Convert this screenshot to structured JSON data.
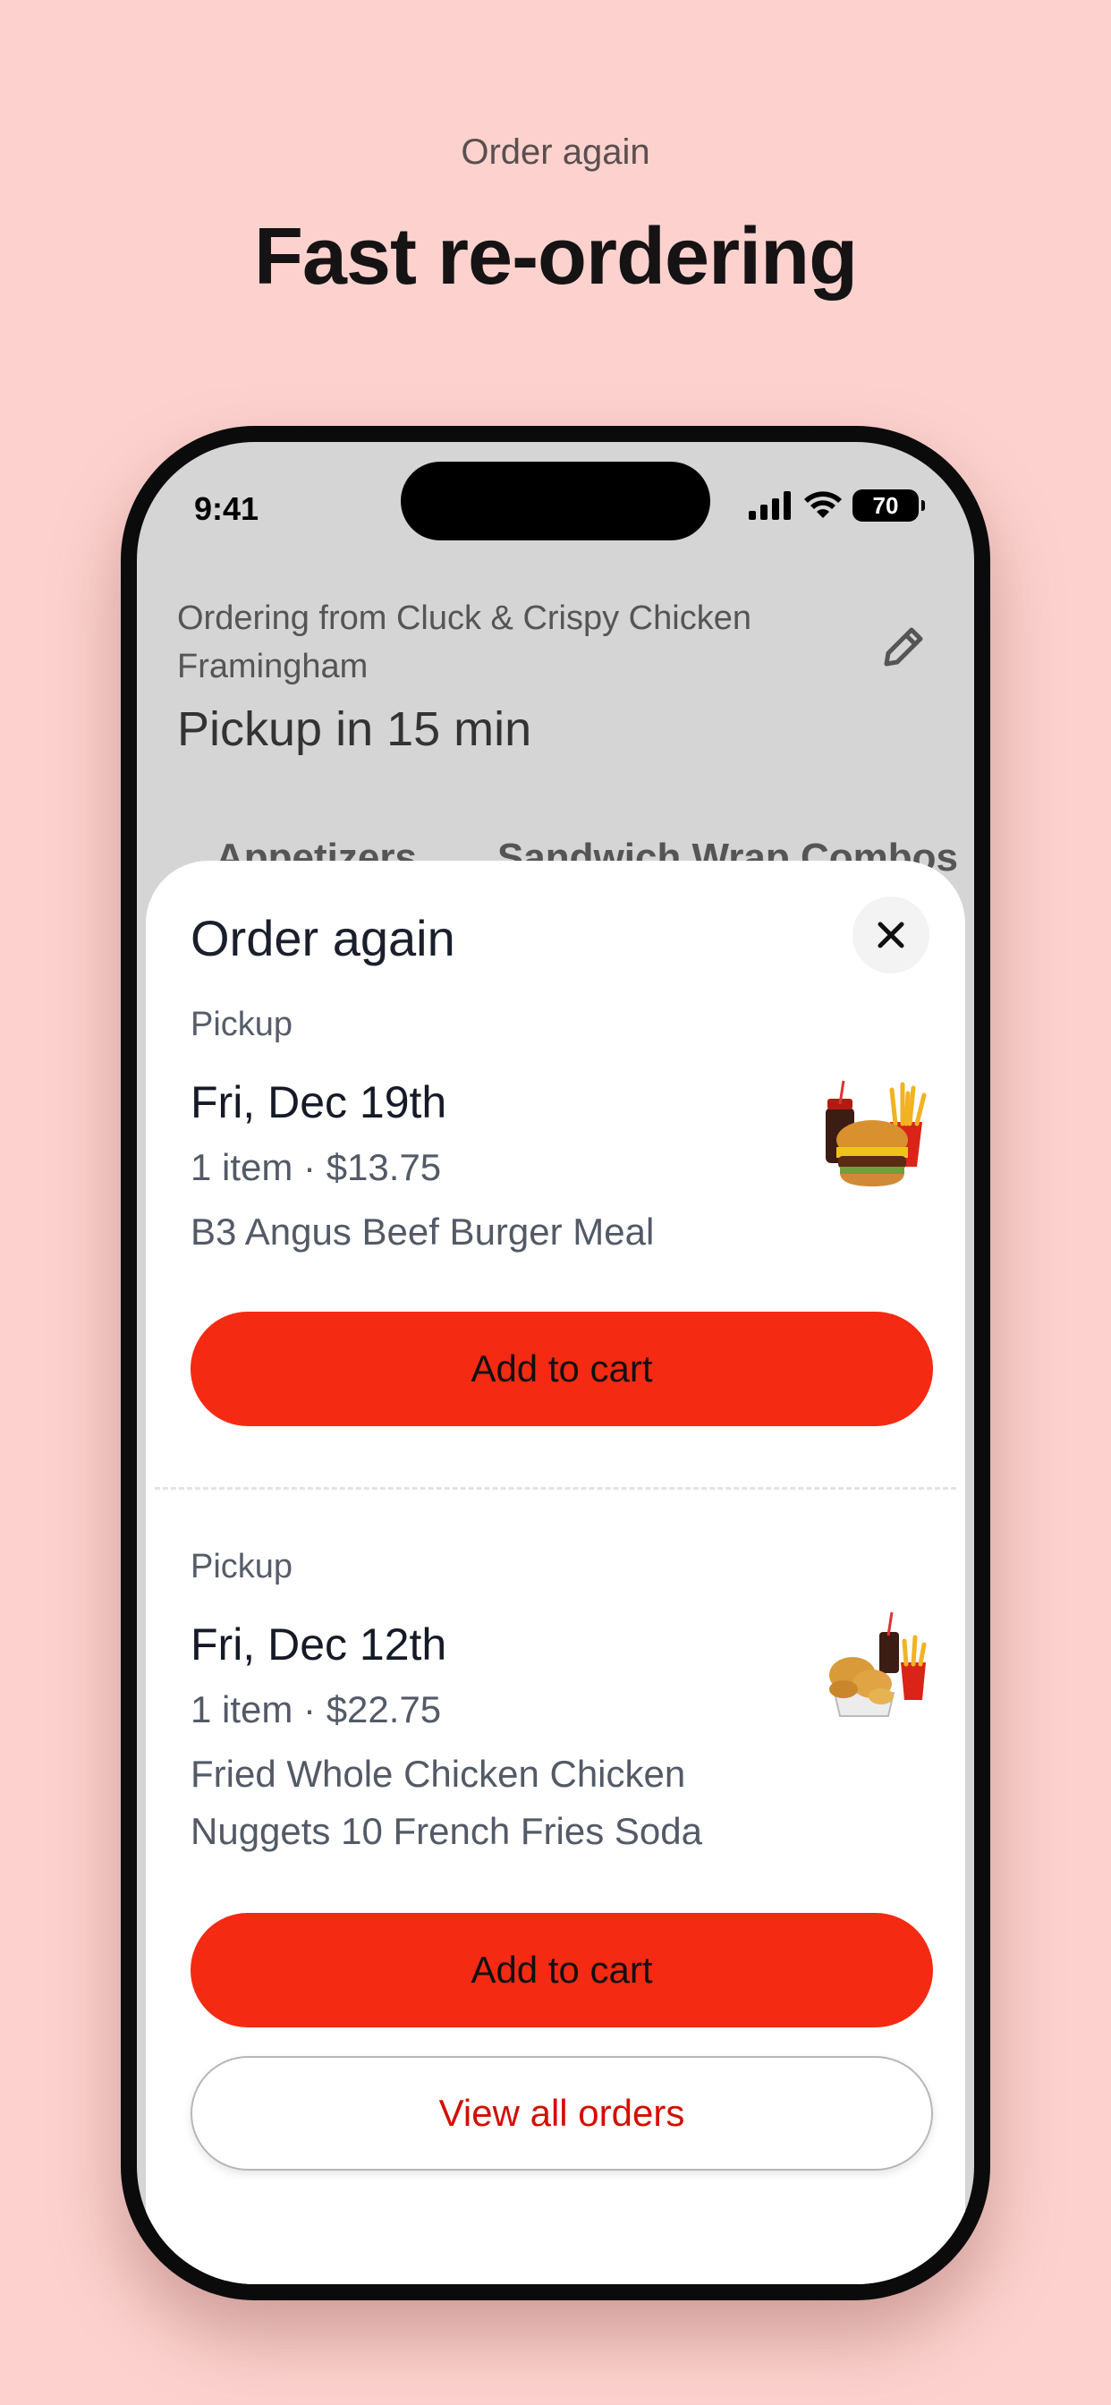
{
  "promo": {
    "eyebrow": "Order again",
    "title": "Fast re-ordering"
  },
  "status_bar": {
    "time": "9:41",
    "battery": "70",
    "icons": [
      "cellular-signal-icon",
      "wifi-icon",
      "battery-icon"
    ]
  },
  "header": {
    "store_line": "Ordering from Cluck & Crispy Chicken Framingham",
    "pickup_time": "Pickup in 15 min",
    "edit_icon": "pencil-icon"
  },
  "categories": [
    "Appetizers",
    "Sandwich Wrap Combos"
  ],
  "sheet": {
    "title": "Order again",
    "close_icon": "close-icon",
    "orders": [
      {
        "type": "Pickup",
        "date": "Fri, Dec 19th",
        "meta": "1 item · $13.75",
        "items": "B3 Angus Beef Burger Meal",
        "image": "burger-meal-image",
        "button": "Add to cart"
      },
      {
        "type": "Pickup",
        "date": "Fri, Dec 12th",
        "meta": "1 item · $22.75",
        "items": "Fried Whole Chicken Chicken Nuggets 10 French Fries Soda",
        "image": "chicken-meal-image",
        "button": "Add to cart"
      }
    ],
    "view_all": "View all orders"
  },
  "colors": {
    "background": "#fdd2ce",
    "accent": "#f52a12",
    "link": "#d40d00"
  }
}
